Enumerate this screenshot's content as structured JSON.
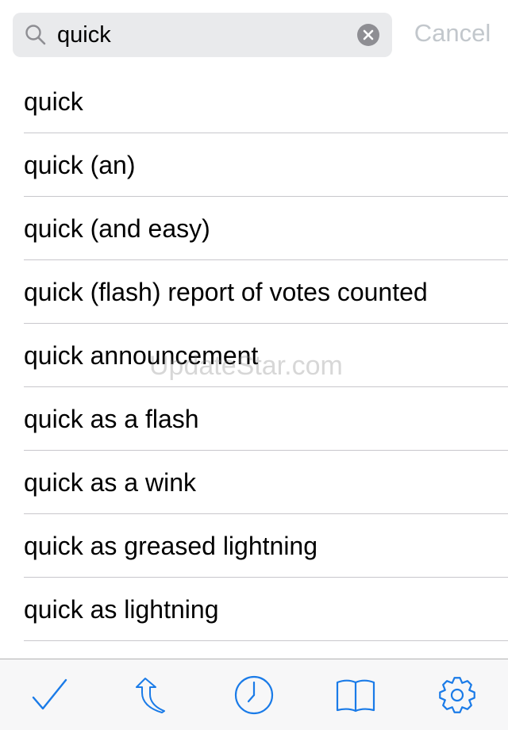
{
  "search": {
    "query": "quick",
    "cancel_label": "Cancel"
  },
  "results": [
    "quick",
    "quick (an)",
    "quick (and easy)",
    "quick (flash) report of votes counted",
    "quick announcement",
    "quick as a flash",
    "quick as a wink",
    "quick as greased lightning",
    "quick as lightning"
  ],
  "watermark": "UpdateStar.com",
  "tab_bar": {
    "icons": [
      "checkmark-icon",
      "share-arrow-icon",
      "clock-icon",
      "book-icon",
      "gear-icon"
    ]
  },
  "colors": {
    "accent": "#1a7be8",
    "search_field_bg": "#e9eaec",
    "cancel_text": "#c2c7cc",
    "divider": "#c8c7cc",
    "tab_bar_bg": "#f7f7f8"
  }
}
